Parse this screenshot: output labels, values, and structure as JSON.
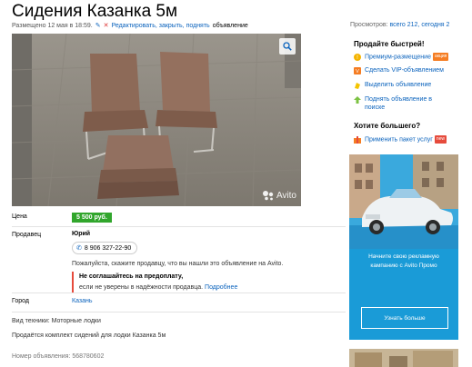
{
  "ad": {
    "title": "Сидения Казанка 5м",
    "posted": "Размещено 12 мая в 18:59.",
    "actions_link": "Редактировать, закрыть, поднять",
    "actions_suffix": "объявление",
    "views_label": "Просмотров:",
    "views_value": "всего 212, сегодня 2",
    "watermark": "Avito"
  },
  "details": {
    "price_label": "Цена",
    "price_value": "5 500 руб.",
    "seller_label": "Продавец",
    "seller_name": "Юрий",
    "phone": "8 906 327-22-90",
    "note": "Пожалуйста, скажите продавцу, что вы нашли это объявление на Avito.",
    "warning_title": "Не соглашайтесь на предоплату,",
    "warning_text": "если не уверены в надёжности продавца.",
    "warning_link": "Подробнее",
    "city_label": "Город",
    "city_value": "Казань",
    "type_line": "Вид техники: Моторные лодки",
    "description": "Продаётся комплект сидений для лодки Казанка 5м",
    "ad_number": "Номер объявления: 568780602"
  },
  "sidebar": {
    "sell_faster_title": "Продайте быстрей!",
    "items": [
      {
        "label": "Премиум-размещение",
        "badge": "акция",
        "icon": "star-icon",
        "color": "#f4b400"
      },
      {
        "label": "Сделать VIP-объявлением",
        "icon": "vip-icon",
        "color": "#f57d23"
      },
      {
        "label": "Выделить объявление",
        "icon": "highlight-icon",
        "color": "#f4c400"
      },
      {
        "label": "Поднять объявление в поиске",
        "icon": "lift-icon",
        "color": "#7cc242"
      }
    ],
    "more_title": "Хотите большего?",
    "package_label": "Применить пакет услуг",
    "package_badge": "new",
    "promo_text": "Начните свою рекламную кампанию с Avito Промо",
    "promo_button": "Узнать больше"
  },
  "colors": {
    "link": "#0b63bd",
    "price_bg": "#31a62c",
    "warning_bar": "#e64b3c",
    "promo_bg": "#1a9bd7"
  }
}
